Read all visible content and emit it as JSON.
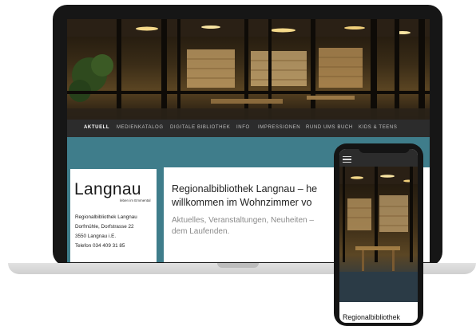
{
  "nav": {
    "items": [
      {
        "label": "AKTUELL",
        "active": true
      },
      {
        "label": "MEDIENKATALOG",
        "active": false
      },
      {
        "label": "DIGITALE BIBLIOTHEK",
        "active": false
      },
      {
        "label": "INFO",
        "active": false
      },
      {
        "label": "IMPRESSIONEN",
        "active": false
      },
      {
        "label": "RUND UMS BUCH",
        "active": false
      },
      {
        "label": "KIDS & TEENS",
        "active": false
      }
    ]
  },
  "logo": {
    "name": "Langnau",
    "tagline": "leben im Emmental"
  },
  "contact": {
    "name": "Regionalbibliothek Langnau",
    "street": "Dorfmühle, Dorfstrasse 22",
    "city": "3550 Langnau i.E.",
    "phone": "Telefon 034 409 31 85"
  },
  "main": {
    "headline_line1": "Regionalbibliothek Langnau – he",
    "headline_line2": "willkommen im Wohnzimmer vo",
    "subline_line1": "Aktuelles, Veranstaltungen, Neuheiten –",
    "subline_line2": "dem Laufenden."
  },
  "mobile": {
    "title": "Regionalbibliothek"
  },
  "colors": {
    "teal": "#3f7d8b",
    "nav_bg": "#2c2c2c",
    "device_frame": "#141414"
  }
}
